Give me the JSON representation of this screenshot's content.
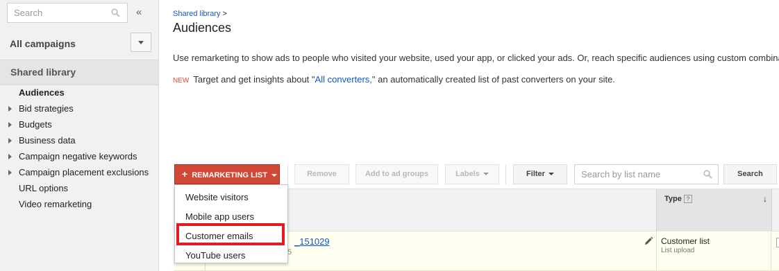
{
  "sidebar": {
    "search_placeholder": "Search",
    "collapse_glyph": "«",
    "all_campaigns": "All campaigns",
    "section": "Shared library",
    "items": [
      {
        "label": "Audiences",
        "expandable": false,
        "active": true
      },
      {
        "label": "Bid strategies",
        "expandable": true
      },
      {
        "label": "Budgets",
        "expandable": true
      },
      {
        "label": "Business data",
        "expandable": true
      },
      {
        "label": "Campaign negative keywords",
        "expandable": true
      },
      {
        "label": "Campaign placement exclusions",
        "expandable": true
      },
      {
        "label": "URL options",
        "expandable": false
      },
      {
        "label": "Video remarketing",
        "expandable": false
      }
    ]
  },
  "header": {
    "breadcrumb": "Shared library",
    "breadcrumb_sep": ">",
    "title": "Audiences"
  },
  "description": "Use remarketing to show ads to people who visited your website, used your app, or clicked your ads. Or, reach specific audiences using custom combinations",
  "notice": {
    "badge": "NEW",
    "text_before": "Target and get insights about \"",
    "link": "All converters,",
    "text_after": "\" an automatically created list of past converters on your site."
  },
  "toolbar": {
    "add_plus": "+",
    "add_label": "REMARKETING LIST",
    "remove": "Remove",
    "add_to_ad_groups": "Add to ad groups",
    "labels": "Labels",
    "filter": "Filter",
    "search_placeholder": "Search by list name",
    "search_button": "Search"
  },
  "menu": {
    "items": [
      "Website visitors",
      "Mobile app users",
      "Customer emails",
      "YouTube users"
    ],
    "highlighted": "Customer emails"
  },
  "table": {
    "columns": [
      {
        "label": "Type",
        "help": "?",
        "sort": "↓"
      }
    ],
    "rows": [
      {
        "name": "_151029",
        "sub": "5",
        "type": "Customer list",
        "type_sub": "List upload"
      }
    ]
  },
  "colors": {
    "accent_red": "#d14836",
    "link_blue": "#1155cc",
    "highlight_box": "#e01b24",
    "row_highlight": "#fffff0"
  }
}
